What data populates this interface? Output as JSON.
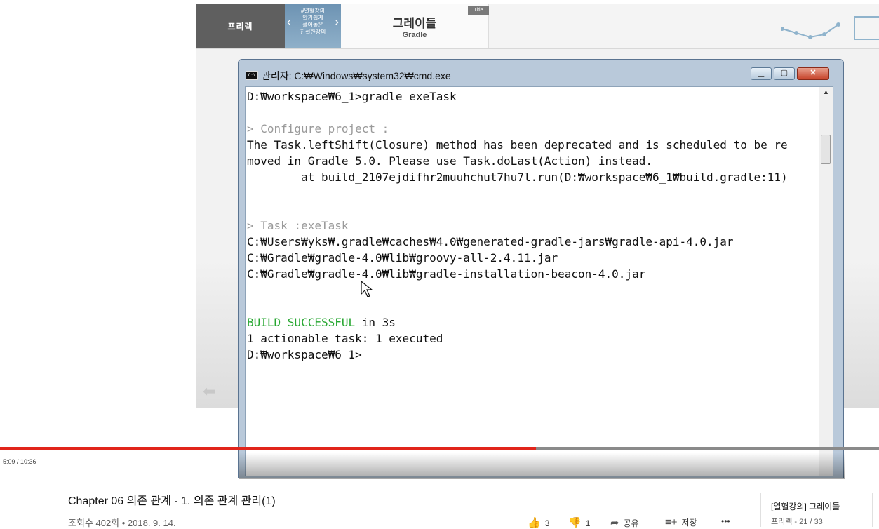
{
  "slide": {
    "brand": "프리렉",
    "promo_lines": [
      "#열혈강의",
      "알기쉽게",
      "풀어놓은",
      "친절한강의"
    ],
    "topic_ko": "그레이들",
    "topic_en": "Gradle",
    "title_tag": "Title"
  },
  "cmd": {
    "title": "관리자: C:₩Windows₩system32₩cmd.exe",
    "icon_label": "C:\\",
    "lines": [
      {
        "text": "D:₩workspace₩6_1>gradle exeTask",
        "style": ""
      },
      {
        "text": "",
        "style": ""
      },
      {
        "text": "> Configure project :",
        "style": "gray"
      },
      {
        "text": "The Task.leftShift(Closure) method has been deprecated and is scheduled to be re",
        "style": ""
      },
      {
        "text": "moved in Gradle 5.0. Please use Task.doLast(Action) instead.",
        "style": ""
      },
      {
        "text": "        at build_2107ejdifhr2muuhchut7hu7l.run(D:₩workspace₩6_1₩build.gradle:11)",
        "style": ""
      },
      {
        "text": "",
        "style": ""
      },
      {
        "text": "",
        "style": ""
      },
      {
        "text": "> Task :exeTask",
        "style": "gray"
      },
      {
        "text": "C:₩Users₩yks₩.gradle₩caches₩4.0₩generated-gradle-jars₩gradle-api-4.0.jar",
        "style": ""
      },
      {
        "text": "C:₩Gradle₩gradle-4.0₩lib₩groovy-all-2.4.11.jar",
        "style": ""
      },
      {
        "text": "C:₩Gradle₩gradle-4.0₩lib₩gradle-installation-beacon-4.0.jar",
        "style": ""
      },
      {
        "text": "",
        "style": ""
      },
      {
        "text": "",
        "style": ""
      },
      {
        "text": "BUILD SUCCESSFUL| in 3s",
        "style": "build"
      },
      {
        "text": "1 actionable task: 1 executed",
        "style": ""
      },
      {
        "text": "D:₩workspace₩6_1>",
        "style": ""
      }
    ]
  },
  "player": {
    "time": "5:09 / 10:36",
    "progress_fraction": 0.61
  },
  "video": {
    "title": "Chapter 06 의존 관계 - 1. 의존 관계 관리(1)",
    "views_date": "조회수 402회 • 2018. 9. 14.",
    "like_count": "3",
    "dislike_count": "1",
    "share_label": "공유",
    "save_label": "저장",
    "more_label": "•••"
  },
  "playlist": {
    "title": "[열혈강의] 그레이들",
    "sub": "프리렉 - 21 / 33"
  }
}
